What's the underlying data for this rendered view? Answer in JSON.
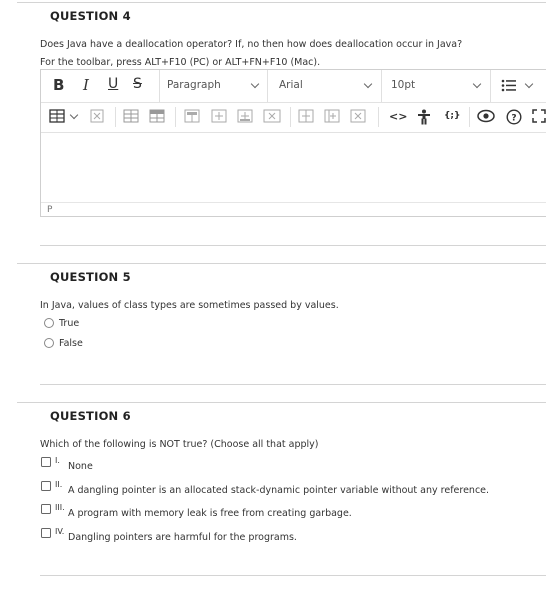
{
  "q4": {
    "title": "QUESTION 4",
    "prompt": "Does Java have a deallocation operator? If, no then how does deallocation occur in Java?",
    "toolbar_hint": "For the toolbar, press ALT+F10 (PC) or ALT+FN+F10 (Mac).",
    "editor": {
      "bold": "B",
      "italic": "I",
      "underline": "U",
      "strike": "S",
      "paragraph": "Paragraph",
      "font": "Arial",
      "size": "10pt",
      "status_path": "P"
    }
  },
  "q5": {
    "title": "QUESTION 5",
    "prompt": "In Java, values of class types are sometimes passed by values.",
    "options": [
      "True",
      "False"
    ]
  },
  "q6": {
    "title": "QUESTION 6",
    "prompt": "Which of the following is NOT true? (Choose all that apply)",
    "options": [
      {
        "num": "I.",
        "text": "None"
      },
      {
        "num": "II.",
        "text": "A dangling pointer is an allocated stack-dynamic pointer variable without any reference."
      },
      {
        "num": "III.",
        "text": "A program with memory leak is free from creating garbage."
      },
      {
        "num": "IV.",
        "text": "Dangling pointers are harmful for the programs."
      }
    ]
  }
}
